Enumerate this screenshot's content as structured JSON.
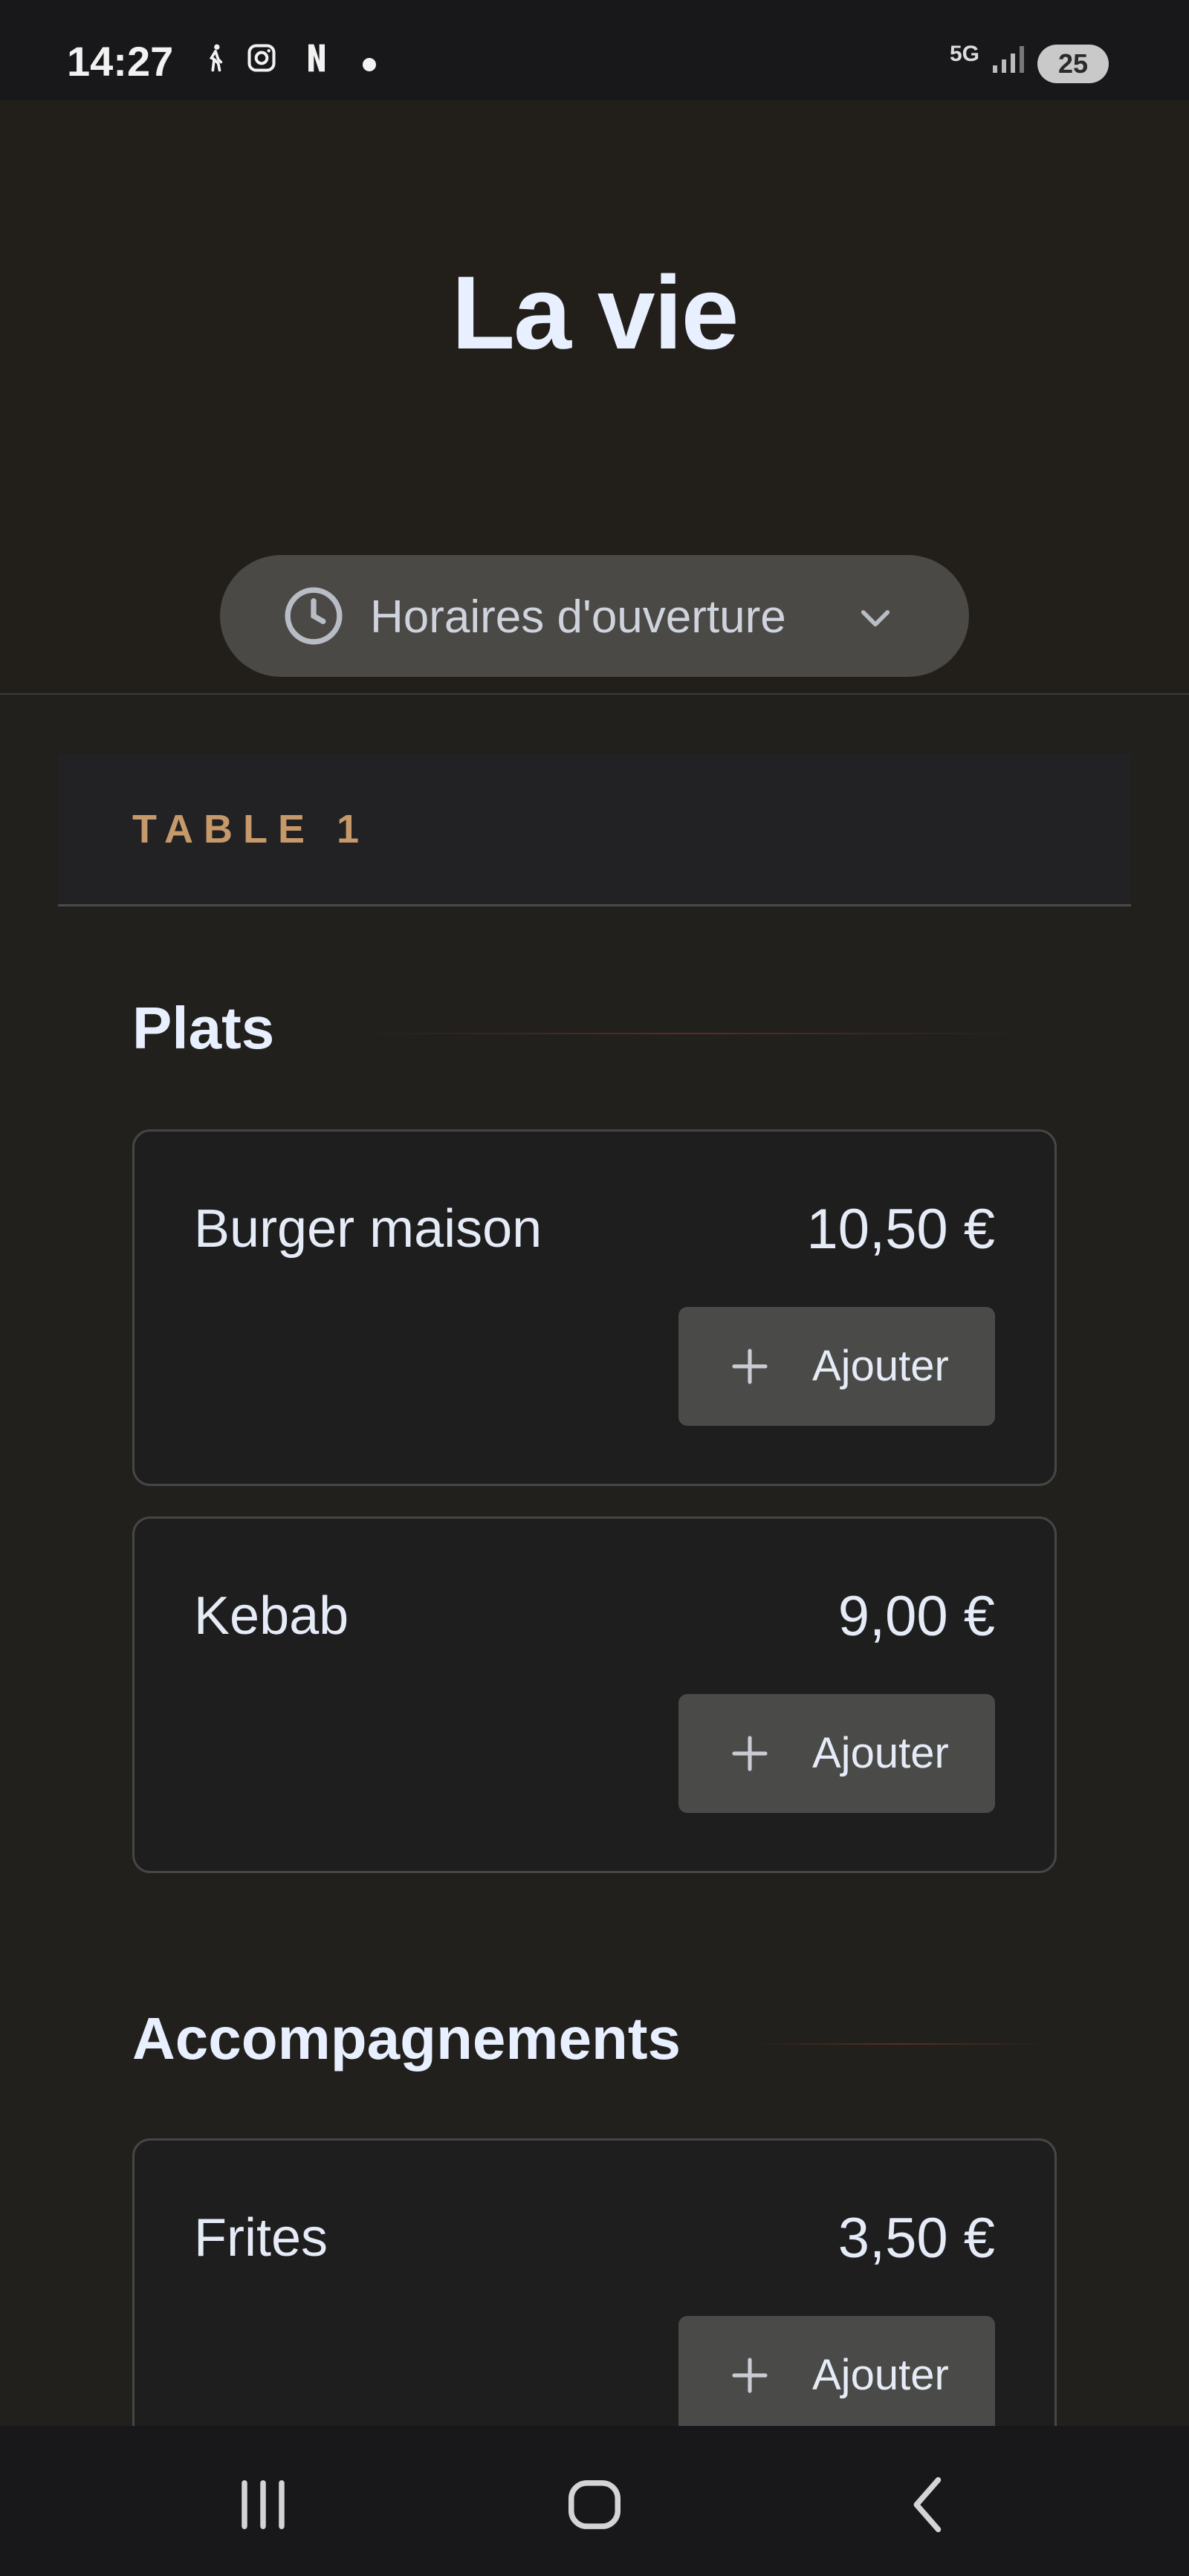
{
  "status_bar": {
    "time": "14:27",
    "network": "5G",
    "battery": "25",
    "icons": [
      "walking-icon",
      "instagram-icon",
      "netflix-icon",
      "notification-dot",
      "signal-icon",
      "battery-icon"
    ]
  },
  "header": {
    "restaurant_name": "La vie",
    "hours_button_label": "Horaires d'ouverture"
  },
  "table": {
    "label": "TABLE 1"
  },
  "sections": [
    {
      "title": "Plats",
      "items": [
        {
          "name": "Burger maison",
          "price": "10,50 €",
          "button_label": "Ajouter"
        },
        {
          "name": "Kebab",
          "price": "9,00 €",
          "button_label": "Ajouter"
        }
      ]
    },
    {
      "title": "Accompagnements",
      "items": [
        {
          "name": "Frites",
          "price": "3,50 €",
          "button_label": "Ajouter"
        }
      ]
    }
  ],
  "colors": {
    "accent": "#c6996b",
    "background": "#22201d",
    "card": "#1e1e1f",
    "button": "#4a4a48",
    "text": "#e6ecf7"
  }
}
